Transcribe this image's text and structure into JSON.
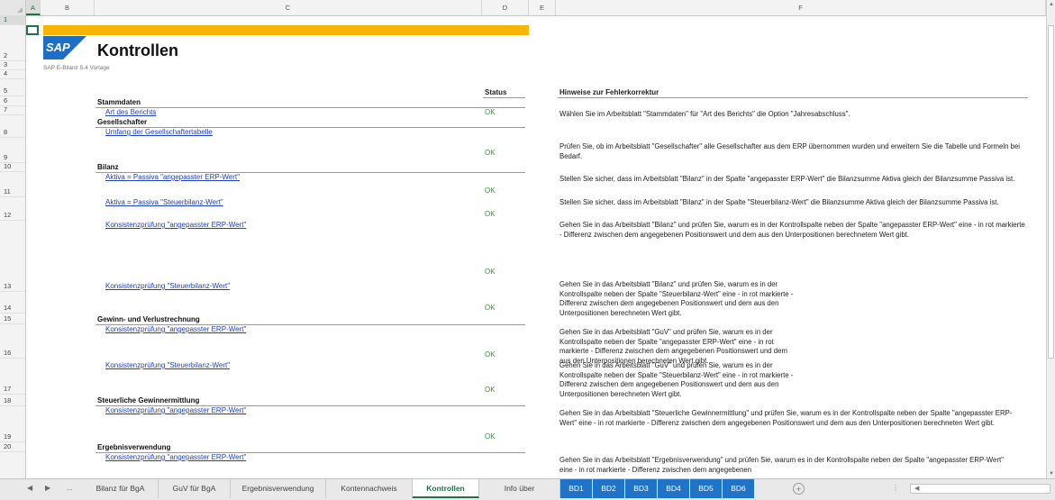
{
  "columns": [
    "A",
    "B",
    "C",
    "D",
    "E",
    "F"
  ],
  "rows": [
    "1",
    "2",
    "3",
    "4",
    "5",
    "6",
    "7",
    "8",
    "9",
    "10",
    "11",
    "12",
    "13",
    "14",
    "15",
    "16",
    "17",
    "18",
    "19",
    "20"
  ],
  "header": {
    "title": "Kontrollen",
    "subtitle": "SAP E-Bilanz 5.4 Vorlage",
    "logo_text": "SAP",
    "status_label": "Status",
    "hints_label": "Hinweise zur Fehlerkorrektur",
    "brand_color": "#f7b500",
    "logo_color": "#1b6fc6"
  },
  "sections": {
    "stammdaten": "Stammdaten",
    "gesellschafter": "Gesellschafter",
    "bilanz": "Bilanz",
    "guv": "Gewinn- und Verlustrechnung",
    "steuer": "Steuerliche Gewinnermittlung",
    "ergebnis": "Ergebnisverwendung"
  },
  "checks": [
    {
      "link": "Art des Berichts",
      "status": "OK",
      "hint": "Wählen Sie im Arbeitsblatt \"Stammdaten\" für \"Art des Berichts\" die Option \"Jahresabschluss\"."
    },
    {
      "link": "Umfang der Gesellschaftertabelle",
      "status": "OK",
      "hint": "Prüfen Sie, ob im Arbeitsblatt \"Gesellschafter\" alle Gesellschafter aus dem ERP übernommen wurden und erweitern Sie die Tabelle und Formeln bei Bedarf."
    },
    {
      "link": "Aktiva = Passiva \"angepasster ERP-Wert\"",
      "status": "OK",
      "hint": "Stellen Sie sicher, dass im Arbeitsblatt \"Bilanz\" in der Spalte \"angepasster ERP-Wert\" die Bilanzsumme Aktiva gleich der Bilanzsumme Passiva ist."
    },
    {
      "link": "Aktiva = Passiva \"Steuerbilanz-Wert\"",
      "status": "OK",
      "hint": "Stellen Sie sicher, dass im Arbeitsblatt \"Bilanz\" in der Spalte \"Steuerbilanz-Wert\" die Bilanzsumme Aktiva gleich der Bilanzsumme Passiva ist."
    },
    {
      "link": "Konsistenzprüfung \"angepasster ERP-Wert\"",
      "status": "OK",
      "hint": "Gehen Sie in das Arbeitsblatt \"Bilanz\" und prüfen Sie, warum es in der Kontrollspalte neben der Spalte \"angepasster ERP-Wert\" eine - in rot markierte - Differenz zwischen dem angegebenen Positionswert und dem aus den Unterpositionen berechnetem Wert gibt."
    },
    {
      "link": "Konsistenzprüfung \"Steuerbilanz-Wert\"",
      "status": "OK",
      "hint": "Gehen Sie in das Arbeitsblatt \"Bilanz\" und prüfen Sie, warum es in der Kontrollspalte neben der Spalte \"Steuerbilanz-Wert\" eine - in rot markierte - Differenz zwischen dem angegebenen Positionswert und dem aus den Unterpositionen berechneten Wert gibt."
    },
    {
      "link": "Konsistenzprüfung \"angepasster ERP-Wert\"",
      "status": "OK",
      "hint": "Gehen Sie in das Arbeitsblatt \"GuV\" und prüfen Sie, warum es in der Kontrollspalte neben der Spalte \"angepasster ERP-Wert\" eine - in rot markierte - Differenz zwischen dem angegebenen Positionswert und dem aus den Unterpositionen berechneten Wert gibt."
    },
    {
      "link": "Konsistenzprüfung \"Steuerbilanz-Wert\"",
      "status": "OK",
      "hint": "Gehen Sie in das Arbeitsblatt \"GuV\" und prüfen Sie, warum es in der Kontrollspalte neben der Spalte \"Steuerbilanz-Wert\" eine - in rot markierte - Differenz zwischen dem angegebenen Positionswert und dem aus den Unterpositionen berechneten Wert gibt."
    },
    {
      "link": "Konsistenzprüfung \"angepasster ERP-Wert\"",
      "status": "OK",
      "hint": "Gehen Sie in das Arbeitsblatt \"Steuerliche Gewinnermittlung\" und prüfen Sie, warum es in der Kontrollspalte neben der Spalte \"angepasster ERP-Wert\" eine - in rot markierte - Differenz zwischen dem angegebenen Positionswert und dem aus den Unterpositionen berechneten Wert gibt."
    },
    {
      "link": "Konsistenzprüfung \"angepasster ERP-Wert\"",
      "status": "",
      "hint": "Gehen Sie in das Arbeitsblatt \"Ergebnisverwendung\" und prüfen Sie, warum es in der Kontrollspalte neben der Spalte \"angepasster ERP-Wert\" eine - in rot markierte - Differenz zwischen dem angegebenen"
    }
  ],
  "tabs": [
    {
      "label": "Bilanz für BgA"
    },
    {
      "label": "GuV für BgA"
    },
    {
      "label": "Ergebnisverwendung"
    },
    {
      "label": "Kontennachweis"
    },
    {
      "label": "Kontrollen"
    },
    {
      "label": "Info über"
    },
    {
      "label": "BD1"
    },
    {
      "label": "BD2"
    },
    {
      "label": "BD3"
    },
    {
      "label": "BD4"
    },
    {
      "label": "BD5"
    },
    {
      "label": "BD6"
    }
  ],
  "tabnav": {
    "prev": "◀",
    "next": "▶",
    "more": "...",
    "add": "+"
  }
}
